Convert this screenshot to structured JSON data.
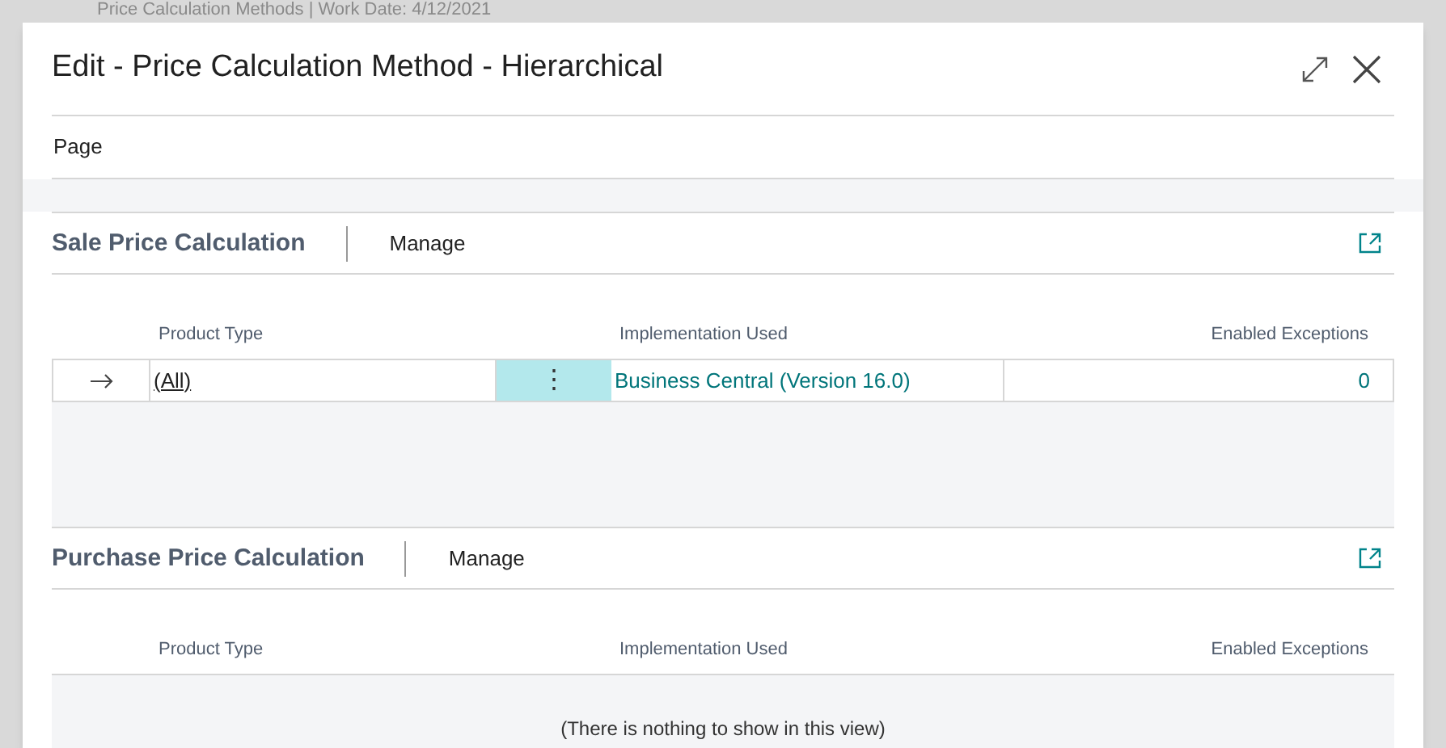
{
  "background": {
    "title": "Price Calculation Methods | Work Date: 4/12/2021"
  },
  "dialog": {
    "title": "Edit - Price Calculation Method - Hierarchical"
  },
  "action_bar": {
    "label": "Page"
  },
  "sections": [
    {
      "title": "Sale Price Calculation",
      "action": "Manage",
      "columns": [
        "Product Type",
        "Implementation Used",
        "Enabled Exceptions"
      ],
      "rows": [
        {
          "selected": true,
          "product_type": "(All)",
          "menu": "⋮",
          "implementation": "Business Central (Version 16.0)",
          "enabled_exceptions": "0"
        }
      ]
    },
    {
      "title": "Purchase Price Calculation",
      "action": "Manage",
      "columns": [
        "Product Type",
        "Implementation Used",
        "Enabled Exceptions"
      ],
      "empty_text": "(There is nothing to show in this view)"
    }
  ]
}
